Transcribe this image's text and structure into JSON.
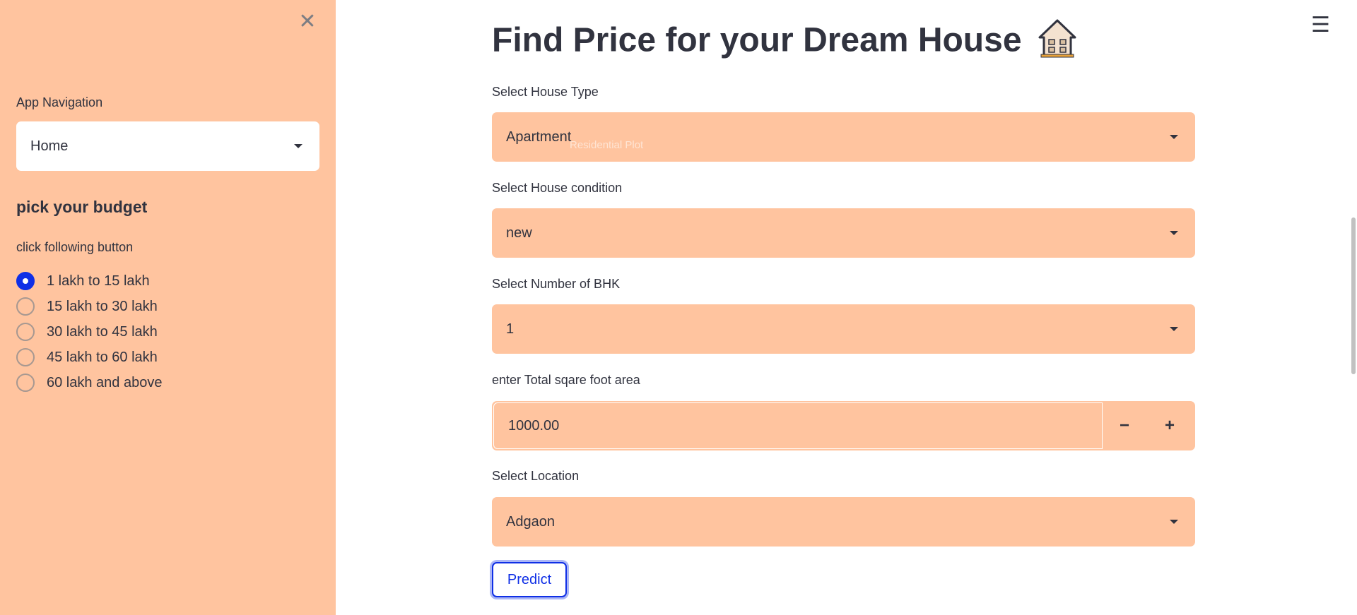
{
  "sidebar": {
    "close_icon": "close-icon",
    "nav_label": "App Navigation",
    "nav_value": "Home",
    "budget_heading": "pick your budget",
    "budget_sub": "click following button",
    "budget_options": [
      "1 lakh to 15 lakh",
      "15 lakh to 30 lakh",
      "30 lakh to 45 lakh",
      "45 lakh to 60 lakh",
      "60 lakh and above"
    ],
    "budget_selected": "1 lakh to 15 lakh"
  },
  "main": {
    "title": "Find Price for your Dream House",
    "title_icon": "house-icon",
    "menu_icon": "hamburger-menu-icon",
    "house_type_label": "Select House Type",
    "house_type_value": "Apartment",
    "house_type_ghost": "Residential Plot",
    "condition_label": "Select House condition",
    "condition_value": "new",
    "bhk_label": "Select Number of BHK",
    "bhk_value": "1",
    "area_label": "enter Total sqare foot area",
    "area_value": "1000.00",
    "decrement_label": "−",
    "increment_label": "+",
    "location_label": "Select Location",
    "location_value": "Adgaon",
    "predict_label": "Predict"
  },
  "colors": {
    "sidebar_bg": "#ffc49f",
    "field_bg": "#ffc49f",
    "accent": "#0f2fe6",
    "text": "#31333f"
  }
}
